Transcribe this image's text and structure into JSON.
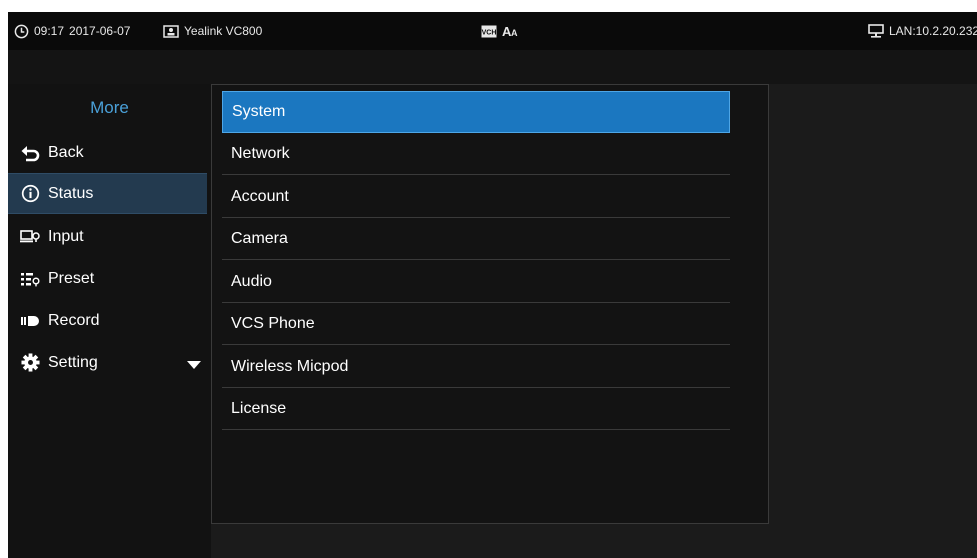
{
  "status_bar": {
    "time": "09:17",
    "date": "2017-06-07",
    "device_name": "Yealink VC800",
    "center_icons": [
      "vch-icon",
      "font-size-icon"
    ],
    "network": "LAN:10.2.20.232"
  },
  "sidebar": {
    "title": "More",
    "items": [
      {
        "label": "Back",
        "icon": "back-arrow-icon"
      },
      {
        "label": "Status",
        "icon": "info-icon",
        "selected": true
      },
      {
        "label": "Input",
        "icon": "input-icon"
      },
      {
        "label": "Preset",
        "icon": "preset-icon"
      },
      {
        "label": "Record",
        "icon": "record-icon"
      },
      {
        "label": "Setting",
        "icon": "gear-icon",
        "expandable": true
      }
    ]
  },
  "main": {
    "items": [
      {
        "label": "System",
        "selected": true
      },
      {
        "label": "Network"
      },
      {
        "label": "Account"
      },
      {
        "label": "Camera"
      },
      {
        "label": "Audio"
      },
      {
        "label": "VCS Phone"
      },
      {
        "label": "Wireless Micpod"
      },
      {
        "label": "License"
      }
    ]
  },
  "colors": {
    "accent_title": "#4aa0d8",
    "selected_item": "#1b77c0",
    "sidebar_selected": "#233a4f",
    "background": "#1b1b1b"
  }
}
